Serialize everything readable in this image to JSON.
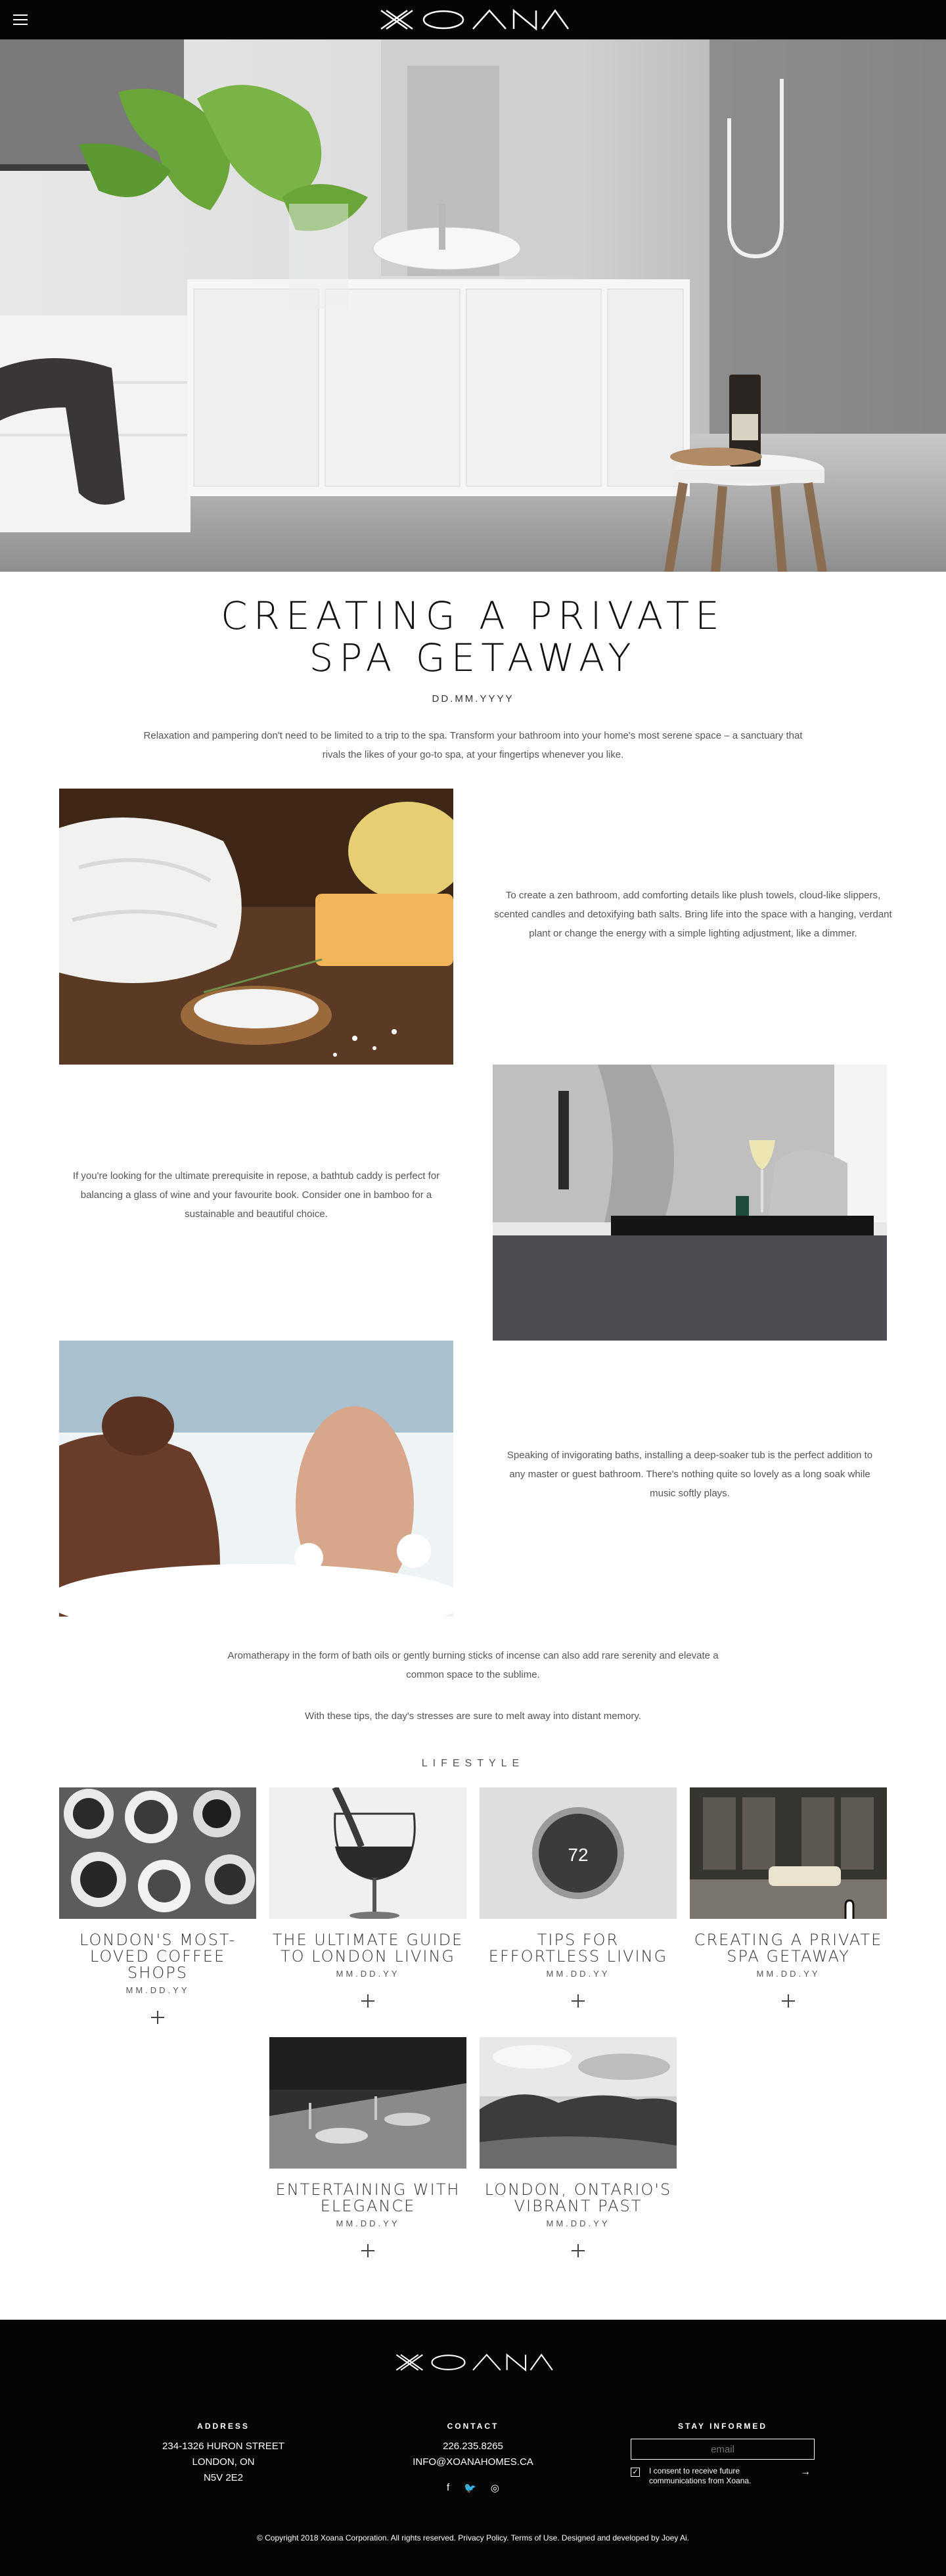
{
  "header": {
    "brand": "XOANA"
  },
  "article": {
    "title_line1": "CREATING A PRIVATE",
    "title_line2": "SPA GETAWAY",
    "date": "DD.MM.YYYY",
    "intro": "Relaxation and pampering don't need to be limited to a trip to the spa. Transform your bathroom into your home's most serene space – a sanctuary that rivals the likes of your go-to spa, at your fingertips whenever you like.",
    "paragraphs": [
      "To create a zen bathroom, add comforting details like plush towels, cloud-like slippers, scented candles and detoxifying bath salts. Bring life into the space with a hanging, verdant plant or change the energy with a simple lighting adjustment, like a dimmer.",
      "If you're looking for the ultimate prerequisite in repose, a bathtub caddy is perfect for balancing a glass of wine and your favourite book. Consider one in bamboo for a sustainable and beautiful choice.",
      "Speaking of invigorating baths, installing a deep-soaker tub is the perfect addition to any master or guest bathroom. There's nothing quite so lovely as a long soak while music softly plays."
    ],
    "closing_1": "Aromatherapy in the form of bath oils or gently burning sticks of incense can also add rare serenity and elevate a common space to the sublime.",
    "closing_2": "With these tips, the day's stresses are sure to melt away into distant memory."
  },
  "lifestyle": {
    "label": "LIFESTYLE",
    "thermostat_value": "72",
    "cards": [
      {
        "title": "LONDON'S MOST-LOVED COFFEE SHOPS",
        "date": "MM.DD.YY"
      },
      {
        "title": "THE ULTIMATE GUIDE TO LONDON LIVING",
        "date": "MM.DD.YY"
      },
      {
        "title": "TIPS FOR EFFORTLESS LIVING",
        "date": "MM.DD.YY"
      },
      {
        "title": "CREATING A PRIVATE SPA GETAWAY",
        "date": "MM.DD.YY"
      },
      {
        "title": "ENTERTAINING WITH ELEGANCE",
        "date": "MM.DD.YY"
      },
      {
        "title": "LONDON, ONTARIO'S VIBRANT PAST",
        "date": "MM.DD.YY"
      }
    ]
  },
  "footer": {
    "brand": "XOANA",
    "address_heading": "ADDRESS",
    "address_line1": "234-1326 HURON STREET",
    "address_line2": "LONDON, ON",
    "address_line3": "N5V 2E2",
    "contact_heading": "CONTACT",
    "phone": "226.235.8265",
    "email_address": "INFO@XOANAHOMES.CA",
    "social_facebook": "f",
    "social_twitter": "🐦",
    "social_instagram": "◎",
    "stay_heading": "STAY INFORMED",
    "email_placeholder": "email",
    "consent_check": "✓",
    "consent": "I consent to receive future communications from Xoana.",
    "submit_arrow": "→",
    "copyright": "© Copyright 2018 Xoana Corporation. All rights reserved.",
    "privacy": "Privacy Policy.",
    "terms": "Terms of Use.",
    "credit": "Designed and developed by Joey Ai."
  },
  "colors": {
    "black": "#050505",
    "white": "#ffffff",
    "text_grey": "#555555"
  }
}
